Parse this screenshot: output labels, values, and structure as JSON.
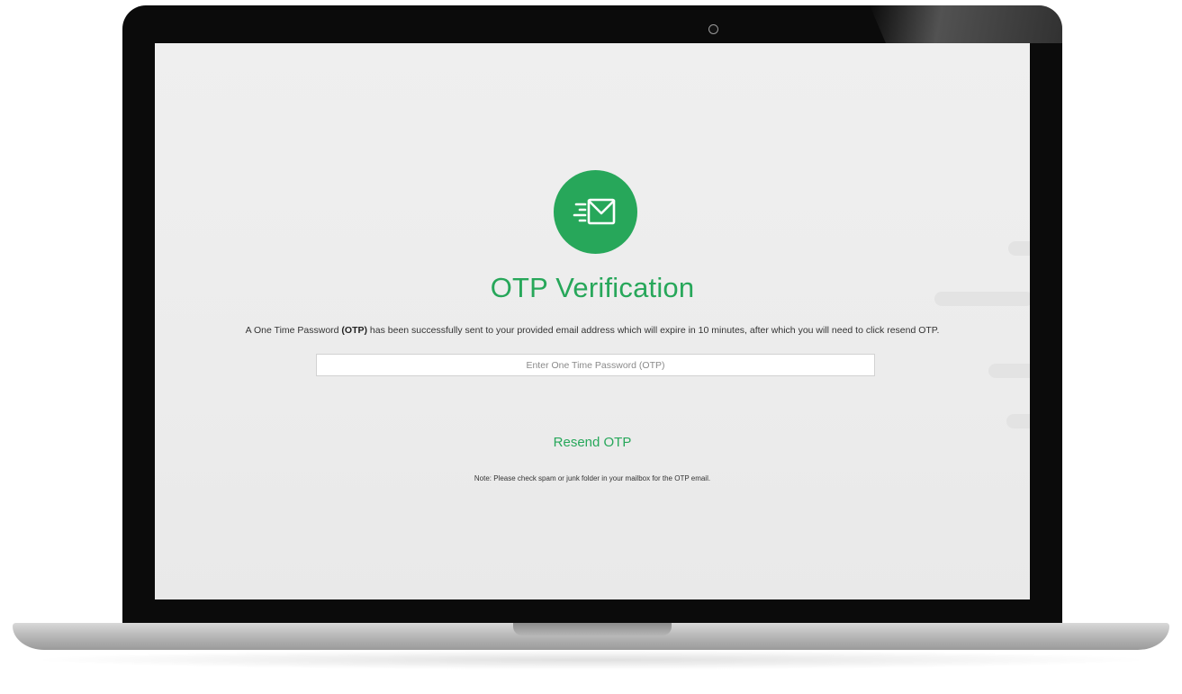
{
  "colors": {
    "accent": "#27a75a",
    "icon_glyph": "#ffffff"
  },
  "icon": "envelope-sent-icon",
  "title": "OTP Verification",
  "description": {
    "before": "A One Time Password ",
    "bold": "(OTP)",
    "after": " has been successfully sent to your provided email address which will expire in 10 minutes, after which you will need to click resend OTP."
  },
  "otp_input": {
    "placeholder": "Enter One Time Password (OTP)",
    "value": ""
  },
  "resend_label": "Resend OTP",
  "note": "Note: Please check spam or junk folder in your mailbox for the OTP email."
}
